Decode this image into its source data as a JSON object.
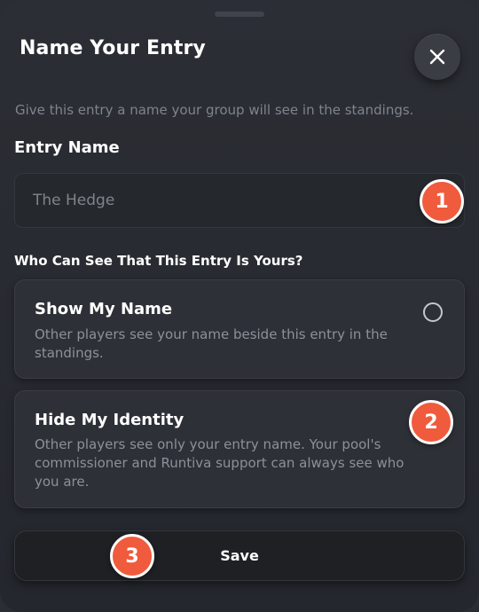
{
  "modal": {
    "title": "Name Your Entry",
    "subtitle": "Give this entry a name your group will see in the standings.",
    "close_icon": "close-icon"
  },
  "entry_name": {
    "label": "Entry Name",
    "value": "",
    "placeholder": "The Hedge"
  },
  "visibility": {
    "question": "Who Can See That This Entry Is Yours?",
    "options": [
      {
        "title": "Show My Name",
        "description": "Other players see your name beside this entry in the standings.",
        "selected": false
      },
      {
        "title": "Hide My Identity",
        "description": "Other players see only your entry name. Your pool's commissioner and Runtiva support can always see who you are.",
        "selected": false
      }
    ]
  },
  "actions": {
    "save_label": "Save"
  },
  "annotations": {
    "badges": [
      "1",
      "2",
      "3"
    ],
    "badge_color": "#ef5b3c"
  },
  "colors": {
    "background": "#2a2d33",
    "card": "#2d3036",
    "text_primary": "#ffffff",
    "text_secondary": "#8c9199"
  }
}
